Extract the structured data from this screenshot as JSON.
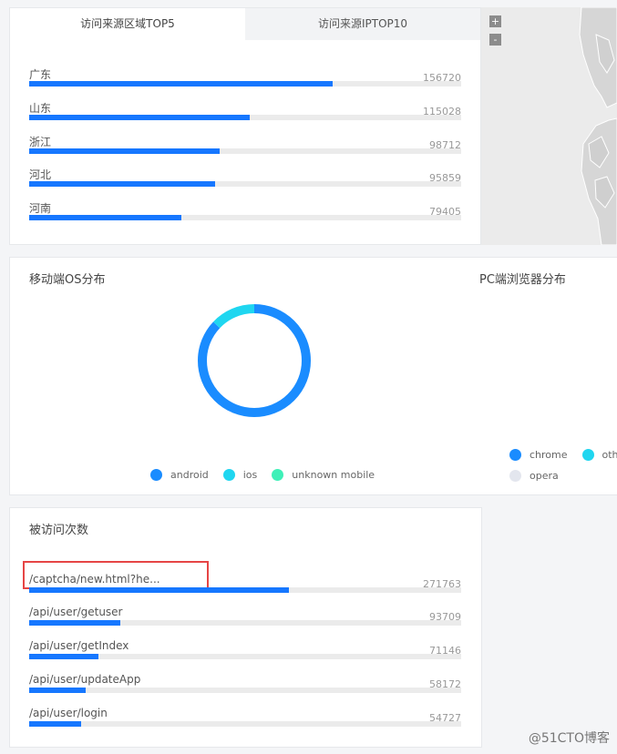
{
  "region": {
    "tabs": [
      {
        "label": "访问来源区域TOP5"
      },
      {
        "label": "访问来源IPTOP10"
      }
    ],
    "rows": [
      {
        "label": "广东",
        "value": "156720",
        "fraction": 0.703
      },
      {
        "label": "山东",
        "value": "115028",
        "fraction": 0.511
      },
      {
        "label": "浙江",
        "value": "98712",
        "fraction": 0.441
      },
      {
        "label": "河北",
        "value": "95859",
        "fraction": 0.43
      },
      {
        "label": "河南",
        "value": "79405",
        "fraction": 0.352
      }
    ]
  },
  "map": {
    "zoom_in": "+",
    "zoom_out": "-"
  },
  "os": {
    "title": "移动端OS分布",
    "legend": [
      {
        "label": "android",
        "color": "#1a8cff"
      },
      {
        "label": "ios",
        "color": "#1fd6f0"
      },
      {
        "label": "unknown mobile",
        "color": "#3ff0b8"
      }
    ],
    "donut": [
      {
        "name": "android",
        "fraction": 0.87,
        "color": "#1a8cff"
      },
      {
        "name": "ios",
        "fraction": 0.13,
        "color": "#1fd6f0"
      }
    ]
  },
  "pc": {
    "title": "PC端浏览器分布",
    "legend": [
      {
        "label": "chrome",
        "color": "#1a8cff"
      },
      {
        "label": "other",
        "color": "#1fd6f0"
      },
      {
        "label": "opera",
        "color": "#e3e6ee"
      }
    ]
  },
  "visits": {
    "title": "被访问次数",
    "rows": [
      {
        "label": "/captcha/new.html?he...",
        "value": "271763",
        "fraction": 0.602
      },
      {
        "label": "/api/user/getuser",
        "value": "93709",
        "fraction": 0.211
      },
      {
        "label": "/api/user/getIndex",
        "value": "71146",
        "fraction": 0.16
      },
      {
        "label": "/api/user/updateApp",
        "value": "58172",
        "fraction": 0.131
      },
      {
        "label": "/api/user/login",
        "value": "54727",
        "fraction": 0.12
      }
    ]
  },
  "watermark": "@51CTO博客"
}
